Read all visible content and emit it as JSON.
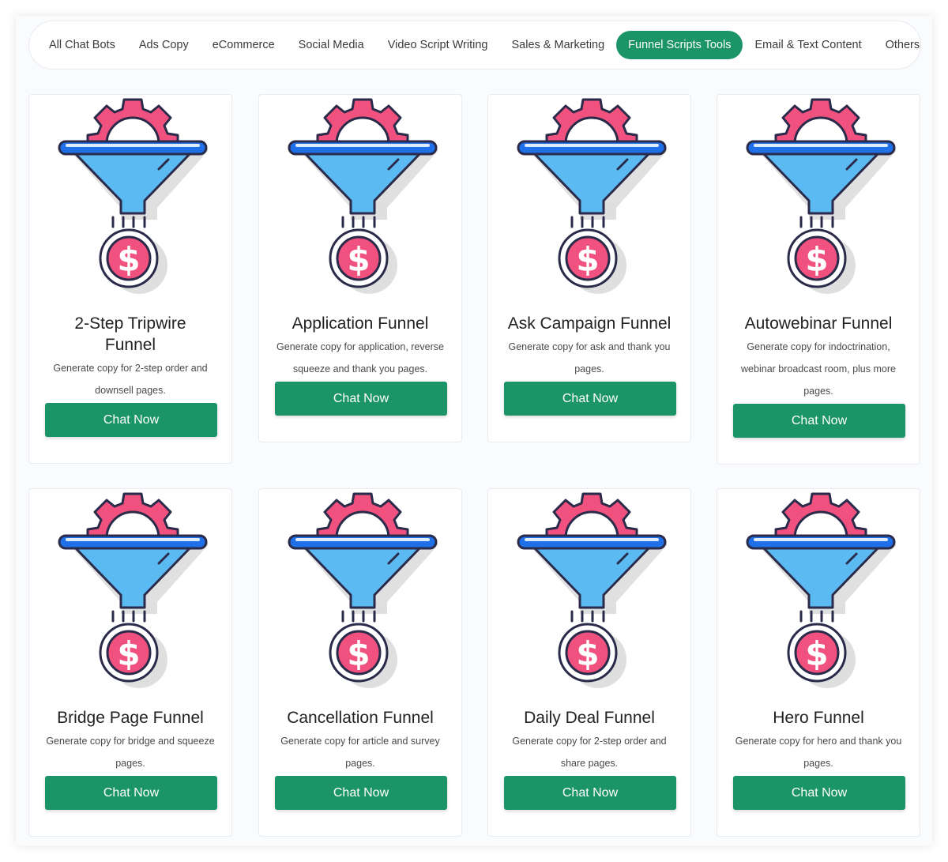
{
  "tabs": [
    {
      "label": "All Chat Bots"
    },
    {
      "label": "Ads Copy"
    },
    {
      "label": "eCommerce"
    },
    {
      "label": "Social Media"
    },
    {
      "label": "Video Script Writing"
    },
    {
      "label": "Sales & Marketing"
    },
    {
      "label": "Funnel Scripts Tools",
      "active": true
    },
    {
      "label": "Email & Text Content"
    },
    {
      "label": "Others"
    }
  ],
  "colors": {
    "accent": "#1b9468",
    "gear": "#f0517e",
    "funnel_rim": "#1e6fe8",
    "funnel_body": "#5cbaf3",
    "coin": "#f0517e",
    "outline": "#2a2a4a"
  },
  "icon_name": "funnel-dollar-icon",
  "cards": [
    {
      "title": "2-Step Tripwire Funnel",
      "desc": "Generate copy for 2-step order and downsell pages.",
      "button": "Chat Now"
    },
    {
      "title": "Application Funnel",
      "desc": "Generate copy for application, reverse squeeze and thank you pages.",
      "button": "Chat Now"
    },
    {
      "title": "Ask Campaign Funnel",
      "desc": "Generate copy for ask and thank you pages.",
      "button": "Chat Now"
    },
    {
      "title": "Autowebinar Funnel",
      "desc": "Generate copy for indoctrination, webinar broadcast room, plus more pages.",
      "button": "Chat Now"
    },
    {
      "title": "Bridge Page Funnel",
      "desc": "Generate copy for bridge and squeeze pages.",
      "button": "Chat Now"
    },
    {
      "title": "Cancellation Funnel",
      "desc": "Generate copy for article and survey pages.",
      "button": "Chat Now"
    },
    {
      "title": "Daily Deal Funnel",
      "desc": "Generate copy for 2-step order and share pages.",
      "button": "Chat Now"
    },
    {
      "title": "Hero Funnel",
      "desc": "Generate copy for hero and thank you pages.",
      "button": "Chat Now"
    }
  ]
}
